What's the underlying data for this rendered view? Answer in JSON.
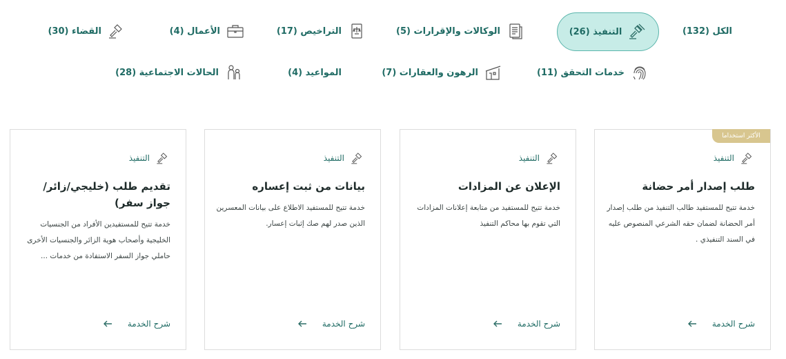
{
  "filters_row1": [
    {
      "label": "الكل (132)",
      "icon": "none"
    },
    {
      "label": "التنفيذ (26)",
      "icon": "gavel-icon",
      "active": true
    },
    {
      "label": "الوكالات والإقرارات (5)",
      "icon": "document-icon"
    },
    {
      "label": "التراخيص (17)",
      "icon": "license-icon"
    },
    {
      "label": "الأعمال (4)",
      "icon": "briefcase-icon"
    },
    {
      "label": "القضاء (30)",
      "icon": "gavel-icon"
    }
  ],
  "filters_row2": [
    {
      "label": "خدمات التحقق (11)",
      "icon": "fingerprint-icon"
    },
    {
      "label": "الرهون والعقارات (7)",
      "icon": "building-icon"
    },
    {
      "label": "المواعيد (4)",
      "icon": "none"
    },
    {
      "label": "الحالات الاجتماعية (28)",
      "icon": "family-icon"
    }
  ],
  "cards": [
    {
      "badge": "الأكثر استخداما",
      "category": "التنفيذ",
      "title": "طلب إصدار أمر حضانة",
      "description": "خدمة تتيح للمستفيد طالب التنفيذ من طلب إصدار أمر الحضانة لضمان حقه الشرعي المنصوص عليه في السند التنفيذي .",
      "more": "شرح الخدمة"
    },
    {
      "badge": "",
      "category": "التنفيذ",
      "title": "الإعلان عن المزادات",
      "description": "خدمة تتيح للمستفيد من متابعة إعلانات المزادات التي تقوم بها محاكم التنفيذ",
      "more": "شرح الخدمة"
    },
    {
      "badge": "",
      "category": "التنفيذ",
      "title": "بيانات من ثبت إعساره",
      "description": "خدمة تتيح للمستفيد الاطلاع على بيانات المعسرين الذين صدر لهم صك إثبات إعسار.",
      "more": "شرح الخدمة"
    },
    {
      "badge": "",
      "category": "التنفيذ",
      "title": "تقديم طلب (خليجي/زائر/جواز سفر)",
      "description": "خدمة تتيح للمستفيدين الأفراد من الجنسيات الخليجية وأصحاب هوية الزائر والجنسيات الأخرى حاملي جواز السفر الاستفادة من خدمات ...",
      "more": "شرح الخدمة"
    }
  ],
  "colors": {
    "accent": "#1f6b64",
    "active_bg": "#c7ece7",
    "badge": "#d8c68f"
  }
}
